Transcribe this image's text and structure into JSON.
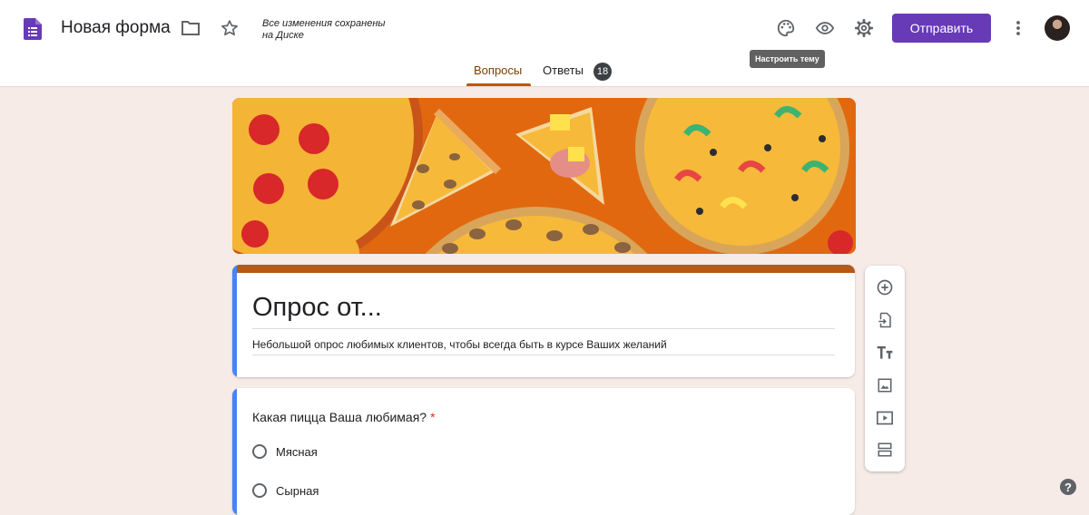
{
  "header": {
    "doc_title": "Новая форма",
    "save_status": "Все изменения сохранены на Диске",
    "send_label": "Отправить",
    "tooltip": "Настроить тему",
    "icons": [
      "forms-logo-icon",
      "folder-icon",
      "star-icon",
      "palette-icon",
      "eye-icon",
      "gear-icon",
      "more-vert-icon"
    ]
  },
  "tabs": [
    {
      "label": "Вопросы",
      "active": true
    },
    {
      "label": "Ответы",
      "badge": "18"
    }
  ],
  "form": {
    "title": "Опрос от...",
    "description": "Небольшой опрос любимых клиентов, чтобы всегда быть в курсе Ваших желаний"
  },
  "question": {
    "text": "Какая пицца Ваша любимая?",
    "required_mark": "*",
    "options": [
      "Мясная",
      "Сырная"
    ]
  },
  "toolbar": {
    "icons": [
      "add-question-icon",
      "import-questions-icon",
      "add-title-icon",
      "add-image-icon",
      "add-video-icon",
      "add-section-icon"
    ]
  },
  "colors": {
    "accent": "#673ab7",
    "theme": "#b35919",
    "background": "#f6ebe6",
    "left_accent": "#4285f4"
  }
}
